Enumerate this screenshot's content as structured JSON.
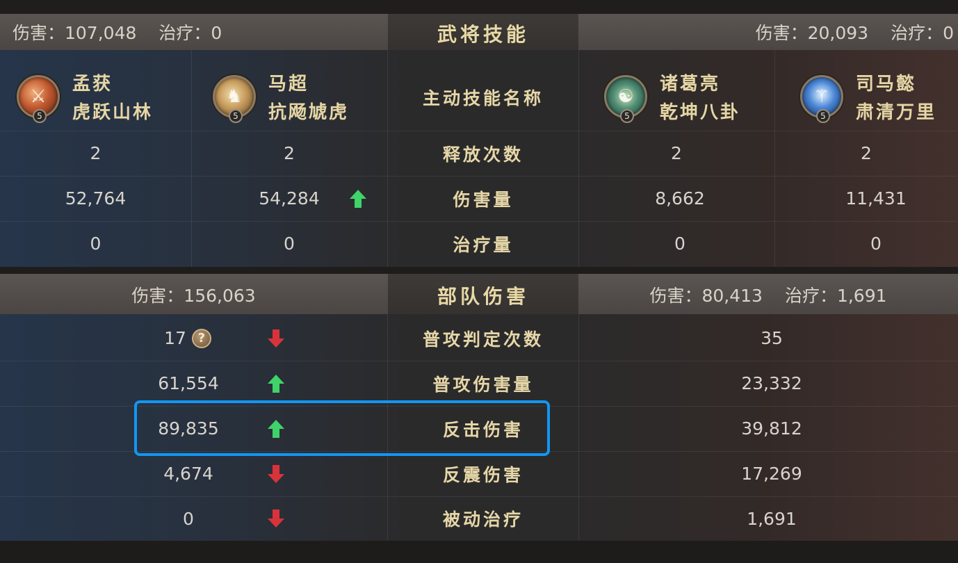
{
  "skills_panel": {
    "title": "武将技能",
    "left_summary": {
      "damage_label": "伤害：107,048",
      "heal_label": "治疗：0"
    },
    "right_summary": {
      "damage_label": "伤害：20,093",
      "heal_label": "治疗：0"
    },
    "row_labels": {
      "skill_name": "主动技能名称",
      "cast_count": "释放次数",
      "damage": "伤害量",
      "healing": "治疗量"
    },
    "heroes": [
      {
        "name": "孟获",
        "skill": "虎跃山林",
        "level": "5",
        "icon": "menghuo-portrait-icon",
        "cast_count": "2",
        "damage": "52,764",
        "healing": "0",
        "damage_trend": ""
      },
      {
        "name": "马超",
        "skill": "抗飏虓虎",
        "level": "5",
        "icon": "machao-portrait-icon",
        "cast_count": "2",
        "damage": "54,284",
        "healing": "0",
        "damage_trend": "up"
      },
      {
        "name": "诸葛亮",
        "skill": "乾坤八卦",
        "level": "5",
        "icon": "zhugeliang-bagua-icon",
        "cast_count": "2",
        "damage": "8,662",
        "healing": "0",
        "damage_trend": ""
      },
      {
        "name": "司马懿",
        "skill": "肃清万里",
        "level": "5",
        "icon": "simayi-blades-icon",
        "cast_count": "2",
        "damage": "11,431",
        "healing": "0",
        "damage_trend": ""
      }
    ]
  },
  "army_panel": {
    "title": "部队伤害",
    "left_summary": {
      "damage_label": "伤害：156,063"
    },
    "right_summary": {
      "damage_label": "伤害：80,413",
      "heal_label": "治疗：1,691"
    },
    "rows": [
      {
        "label": "普攻判定次数",
        "left": "17",
        "right": "35",
        "trend": "down",
        "help": "?"
      },
      {
        "label": "普攻伤害量",
        "left": "61,554",
        "right": "23,332",
        "trend": "up"
      },
      {
        "label": "反击伤害",
        "left": "89,835",
        "right": "39,812",
        "trend": "up",
        "highlighted": true
      },
      {
        "label": "反震伤害",
        "left": "4,674",
        "right": "17,269",
        "trend": "down"
      },
      {
        "label": "被动治疗",
        "left": "0",
        "right": "1,691",
        "trend": "down"
      }
    ]
  },
  "colors": {
    "up_arrow": "#3fd36a",
    "down_arrow": "#d8333a",
    "highlight_border": "#1296f3",
    "label_gold": "#e6d7a8"
  }
}
